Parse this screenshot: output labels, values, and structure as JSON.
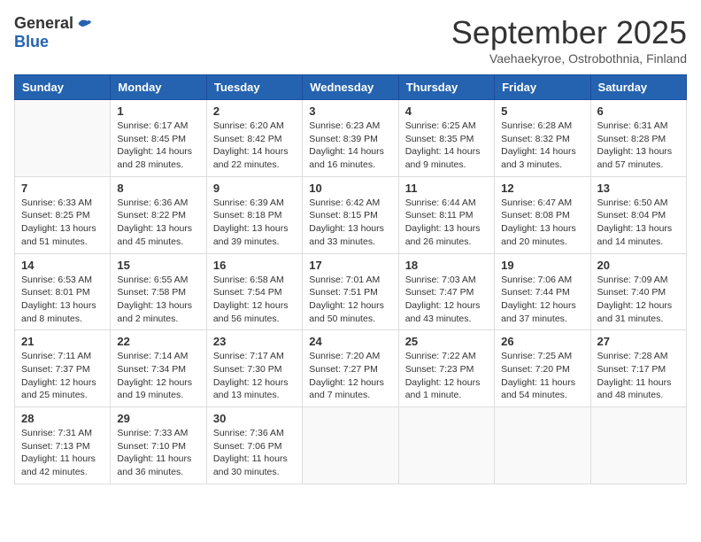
{
  "logo": {
    "general": "General",
    "blue": "Blue"
  },
  "header": {
    "month": "September 2025",
    "location": "Vaehaekyroe, Ostrobothnia, Finland"
  },
  "days_of_week": [
    "Sunday",
    "Monday",
    "Tuesday",
    "Wednesday",
    "Thursday",
    "Friday",
    "Saturday"
  ],
  "weeks": [
    [
      {
        "day": "",
        "info": ""
      },
      {
        "day": "1",
        "info": "Sunrise: 6:17 AM\nSunset: 8:45 PM\nDaylight: 14 hours\nand 28 minutes."
      },
      {
        "day": "2",
        "info": "Sunrise: 6:20 AM\nSunset: 8:42 PM\nDaylight: 14 hours\nand 22 minutes."
      },
      {
        "day": "3",
        "info": "Sunrise: 6:23 AM\nSunset: 8:39 PM\nDaylight: 14 hours\nand 16 minutes."
      },
      {
        "day": "4",
        "info": "Sunrise: 6:25 AM\nSunset: 8:35 PM\nDaylight: 14 hours\nand 9 minutes."
      },
      {
        "day": "5",
        "info": "Sunrise: 6:28 AM\nSunset: 8:32 PM\nDaylight: 14 hours\nand 3 minutes."
      },
      {
        "day": "6",
        "info": "Sunrise: 6:31 AM\nSunset: 8:28 PM\nDaylight: 13 hours\nand 57 minutes."
      }
    ],
    [
      {
        "day": "7",
        "info": "Sunrise: 6:33 AM\nSunset: 8:25 PM\nDaylight: 13 hours\nand 51 minutes."
      },
      {
        "day": "8",
        "info": "Sunrise: 6:36 AM\nSunset: 8:22 PM\nDaylight: 13 hours\nand 45 minutes."
      },
      {
        "day": "9",
        "info": "Sunrise: 6:39 AM\nSunset: 8:18 PM\nDaylight: 13 hours\nand 39 minutes."
      },
      {
        "day": "10",
        "info": "Sunrise: 6:42 AM\nSunset: 8:15 PM\nDaylight: 13 hours\nand 33 minutes."
      },
      {
        "day": "11",
        "info": "Sunrise: 6:44 AM\nSunset: 8:11 PM\nDaylight: 13 hours\nand 26 minutes."
      },
      {
        "day": "12",
        "info": "Sunrise: 6:47 AM\nSunset: 8:08 PM\nDaylight: 13 hours\nand 20 minutes."
      },
      {
        "day": "13",
        "info": "Sunrise: 6:50 AM\nSunset: 8:04 PM\nDaylight: 13 hours\nand 14 minutes."
      }
    ],
    [
      {
        "day": "14",
        "info": "Sunrise: 6:53 AM\nSunset: 8:01 PM\nDaylight: 13 hours\nand 8 minutes."
      },
      {
        "day": "15",
        "info": "Sunrise: 6:55 AM\nSunset: 7:58 PM\nDaylight: 13 hours\nand 2 minutes."
      },
      {
        "day": "16",
        "info": "Sunrise: 6:58 AM\nSunset: 7:54 PM\nDaylight: 12 hours\nand 56 minutes."
      },
      {
        "day": "17",
        "info": "Sunrise: 7:01 AM\nSunset: 7:51 PM\nDaylight: 12 hours\nand 50 minutes."
      },
      {
        "day": "18",
        "info": "Sunrise: 7:03 AM\nSunset: 7:47 PM\nDaylight: 12 hours\nand 43 minutes."
      },
      {
        "day": "19",
        "info": "Sunrise: 7:06 AM\nSunset: 7:44 PM\nDaylight: 12 hours\nand 37 minutes."
      },
      {
        "day": "20",
        "info": "Sunrise: 7:09 AM\nSunset: 7:40 PM\nDaylight: 12 hours\nand 31 minutes."
      }
    ],
    [
      {
        "day": "21",
        "info": "Sunrise: 7:11 AM\nSunset: 7:37 PM\nDaylight: 12 hours\nand 25 minutes."
      },
      {
        "day": "22",
        "info": "Sunrise: 7:14 AM\nSunset: 7:34 PM\nDaylight: 12 hours\nand 19 minutes."
      },
      {
        "day": "23",
        "info": "Sunrise: 7:17 AM\nSunset: 7:30 PM\nDaylight: 12 hours\nand 13 minutes."
      },
      {
        "day": "24",
        "info": "Sunrise: 7:20 AM\nSunset: 7:27 PM\nDaylight: 12 hours\nand 7 minutes."
      },
      {
        "day": "25",
        "info": "Sunrise: 7:22 AM\nSunset: 7:23 PM\nDaylight: 12 hours\nand 1 minute."
      },
      {
        "day": "26",
        "info": "Sunrise: 7:25 AM\nSunset: 7:20 PM\nDaylight: 11 hours\nand 54 minutes."
      },
      {
        "day": "27",
        "info": "Sunrise: 7:28 AM\nSunset: 7:17 PM\nDaylight: 11 hours\nand 48 minutes."
      }
    ],
    [
      {
        "day": "28",
        "info": "Sunrise: 7:31 AM\nSunset: 7:13 PM\nDaylight: 11 hours\nand 42 minutes."
      },
      {
        "day": "29",
        "info": "Sunrise: 7:33 AM\nSunset: 7:10 PM\nDaylight: 11 hours\nand 36 minutes."
      },
      {
        "day": "30",
        "info": "Sunrise: 7:36 AM\nSunset: 7:06 PM\nDaylight: 11 hours\nand 30 minutes."
      },
      {
        "day": "",
        "info": ""
      },
      {
        "day": "",
        "info": ""
      },
      {
        "day": "",
        "info": ""
      },
      {
        "day": "",
        "info": ""
      }
    ]
  ]
}
